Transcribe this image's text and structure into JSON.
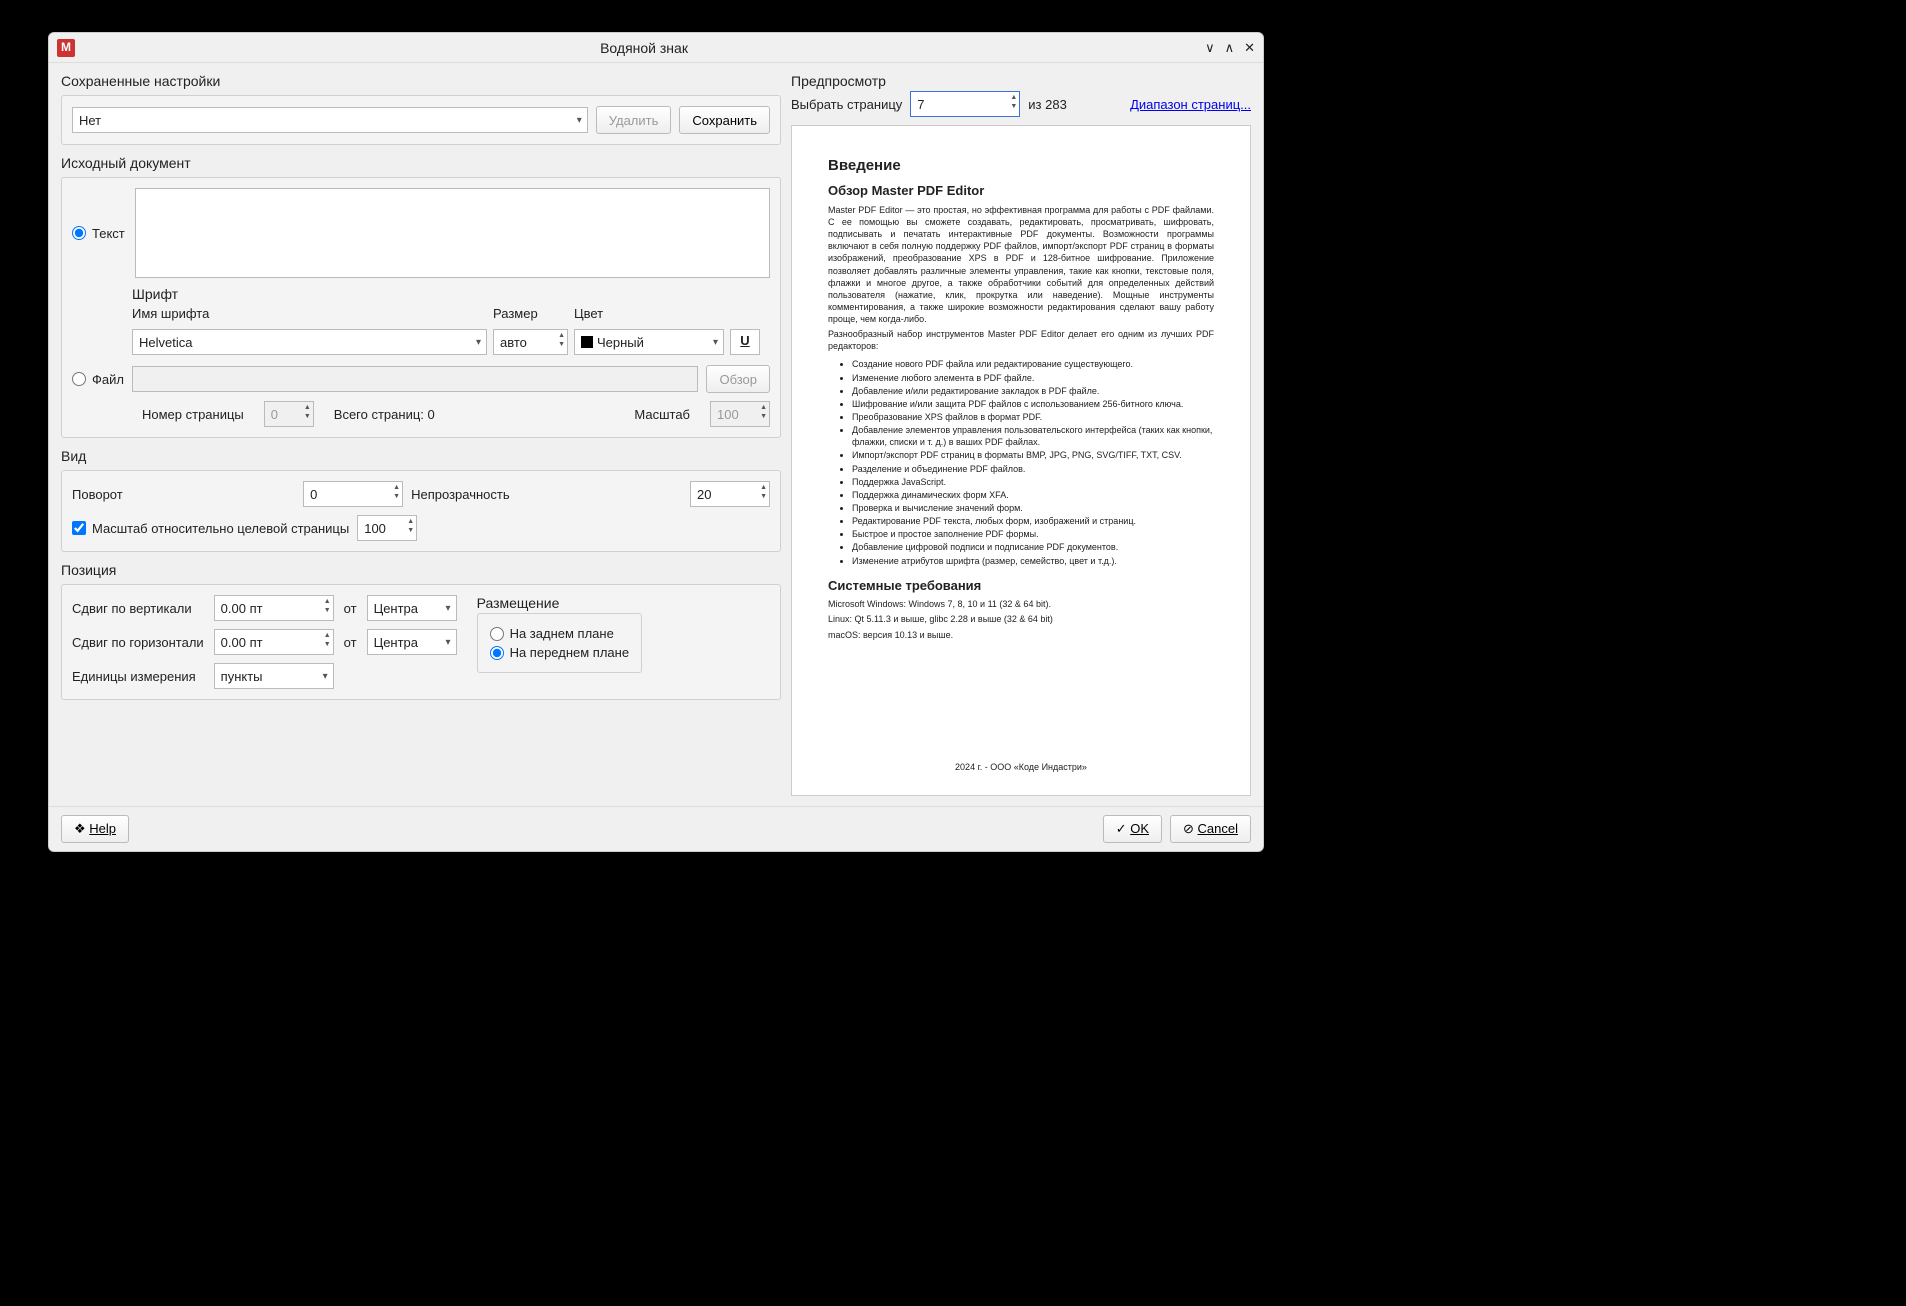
{
  "title": "Водяной знак",
  "sections": {
    "saved": "Сохраненные настройки",
    "source": "Исходный документ",
    "font": "Шрифт",
    "view": "Вид",
    "position": "Позиция",
    "preview": "Предпросмотр",
    "placement": "Размещение"
  },
  "saved": {
    "preset": "Нет",
    "delete": "Удалить",
    "save": "Сохранить"
  },
  "source": {
    "text_radio": "Текст",
    "file_radio": "Файл",
    "browse": "Обзор",
    "page_num_label": "Номер страницы",
    "page_num": "0",
    "total_pages": "Всего страниц: 0",
    "scale_label": "Масштаб",
    "scale": "100"
  },
  "font": {
    "name_label": "Имя шрифта",
    "size_label": "Размер",
    "color_label": "Цвет",
    "name": "Helvetica",
    "size": "авто",
    "color": "Черный"
  },
  "view": {
    "rotate_label": "Поворот",
    "rotate": "0",
    "opacity_label": "Непрозрачность",
    "opacity": "20",
    "scale_cb": "Масштаб относительно целевой страницы",
    "scale_rel": "100"
  },
  "position": {
    "vshift_label": "Сдвиг по вертикали",
    "vshift": "0.00 пт",
    "from": "от",
    "center": "Центра",
    "hshift_label": "Сдвиг по горизонтали",
    "hshift": "0.00 пт",
    "units_label": "Единицы измерения",
    "units": "пункты",
    "back": "На заднем плане",
    "front": "На переднем плане"
  },
  "preview": {
    "select_page": "Выбрать страницу",
    "page": "7",
    "of": "из  283",
    "range": "Диапазон страниц...",
    "doc": {
      "h_intro": "Введение",
      "h_overview": "Обзор Master PDF Editor",
      "para1": "Master PDF Editor — это простая, но эффективная программа для работы с PDF файлами. С ее помощью вы сможете создавать, редактировать, просматривать, шифровать, подписывать и печатать интерактивные PDF документы. Возможности программы включают в себя полную поддержку PDF файлов, импорт/экспорт PDF страниц в форматы изображений, преобразование XPS в PDF и 128-битное шифрование. Приложение позволяет добавлять различные элементы управления, такие как кнопки, текстовые поля, флажки и многое другое, а также обработчики событий для определенных действий пользователя (нажатие, клик, прокрутка или наведение). Мощные инструменты комментирования, а также широкие возможности редактирования сделают вашу работу проще, чем когда-либо.",
      "para2": "Разнообразный набор инструментов Master PDF Editor делает его одним из лучших PDF редакторов:",
      "bullets": [
        "Создание нового PDF файла или редактирование существующего.",
        "Изменение любого элемента в PDF файле.",
        "Добавление и/или редактирование закладок в PDF файле.",
        "Шифрование и/или защита PDF файлов с использованием 256-битного ключа.",
        "Преобразование XPS файлов в формат PDF.",
        "Добавление элементов управления пользовательского интерфейса (таких как кнопки, флажки, списки и т. д.) в ваших PDF файлах.",
        "Импорт/экспорт PDF страниц в форматы BMP, JPG, PNG, SVG/TIFF, TXT, CSV.",
        "Разделение и объединение PDF файлов.",
        "Поддержка JavaScript.",
        "Поддержка динамических форм XFA.",
        "Проверка и вычисление значений форм.",
        "Редактирование PDF текста, любых форм, изображений и страниц.",
        "Быстрое и простое заполнение PDF формы.",
        "Добавление цифровой подписи и подписание PDF документов.",
        "Изменение атрибутов шрифта (размер, семейство, цвет и т.д.)."
      ],
      "h_sysreq": "Системные требования",
      "sys1": "Microsoft Windows: Windows 7, 8, 10 и 11 (32 & 64 bit).",
      "sys2": "Linux: Qt 5.11.3 и выше, glibc 2.28 и выше (32 & 64 bit)",
      "sys3": "macOS: версия 10.13 и выше.",
      "footer": "2024 г. - ООО «Коде Индастри»"
    }
  },
  "buttons": {
    "help": "Help",
    "ok": "OK",
    "cancel": "Cancel"
  }
}
